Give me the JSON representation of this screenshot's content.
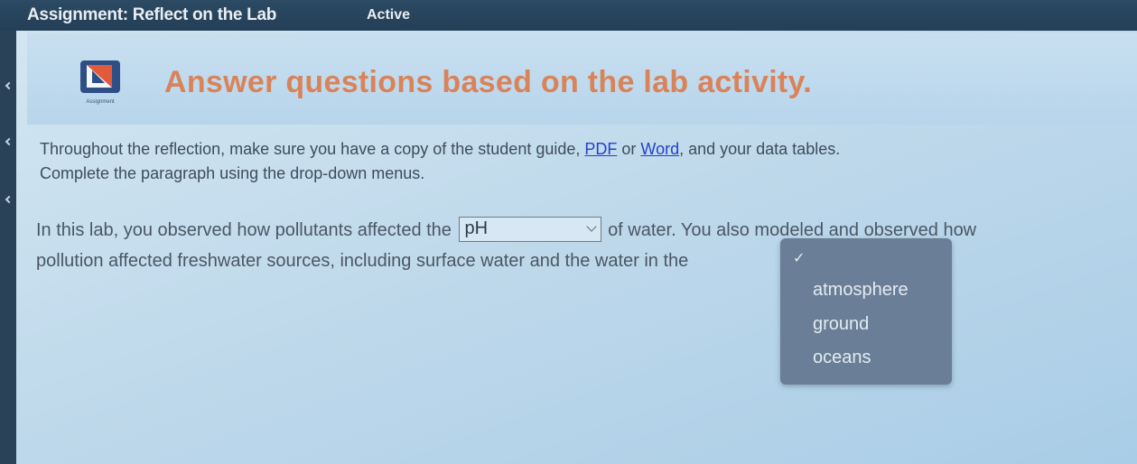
{
  "topbar": {
    "title": "Assignment: Reflect on the Lab",
    "status": "Active"
  },
  "header": {
    "logo_caption": "Assignment",
    "heading": "Answer questions based on the lab activity."
  },
  "intro": {
    "part1": "Throughout the reflection, make sure you have a copy of the student guide, ",
    "pdf_link": "PDF",
    "or": " or ",
    "word_link": "Word",
    "part2": ", and your data tables.",
    "line2": "Complete the paragraph using the drop-down menus."
  },
  "paragraph": {
    "before_select": "In this lab, you observed how pollutants affected the",
    "select1_value": "pH",
    "after_select": "of water. You also modeled and observed how",
    "line2": "pollution affected freshwater sources, including surface water and the water in the"
  },
  "dropdown": {
    "check": "✓",
    "options": [
      "atmosphere",
      "ground",
      "oceans"
    ]
  },
  "colors": {
    "heading": "#d9835a",
    "link": "#2342c9",
    "dropdown_bg": "#6a7e97"
  }
}
